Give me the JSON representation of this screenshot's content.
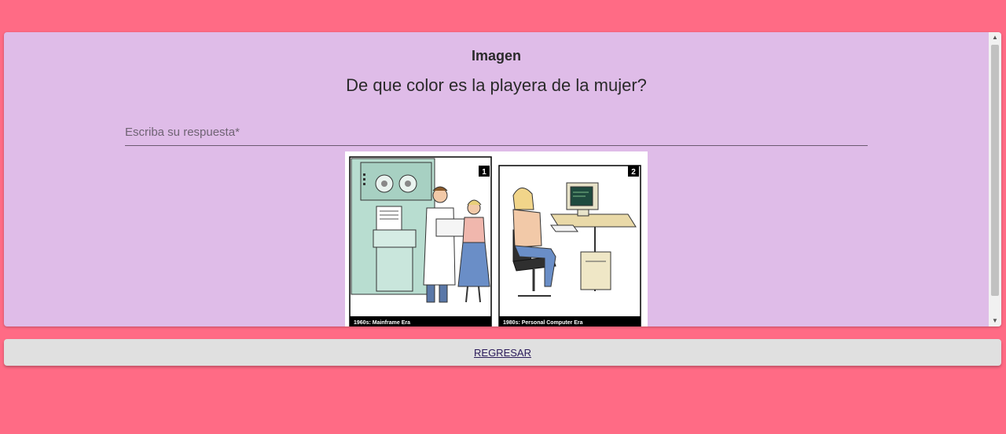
{
  "card": {
    "title": "Imagen",
    "question": "De que color es la playera de la mujer?"
  },
  "answer": {
    "placeholder": "Escriba su respuesta*",
    "value": ""
  },
  "illustration": {
    "panels": [
      {
        "number": "1",
        "caption": "1960s: Mainframe Era"
      },
      {
        "number": "2",
        "caption": "1980s: Personal Computer Era"
      }
    ]
  },
  "actions": {
    "back_label": "REGRESAR"
  },
  "colors": {
    "page_background": "#ff6b85",
    "card_background": "#dfbce8",
    "button_background": "#e0e0e0"
  }
}
